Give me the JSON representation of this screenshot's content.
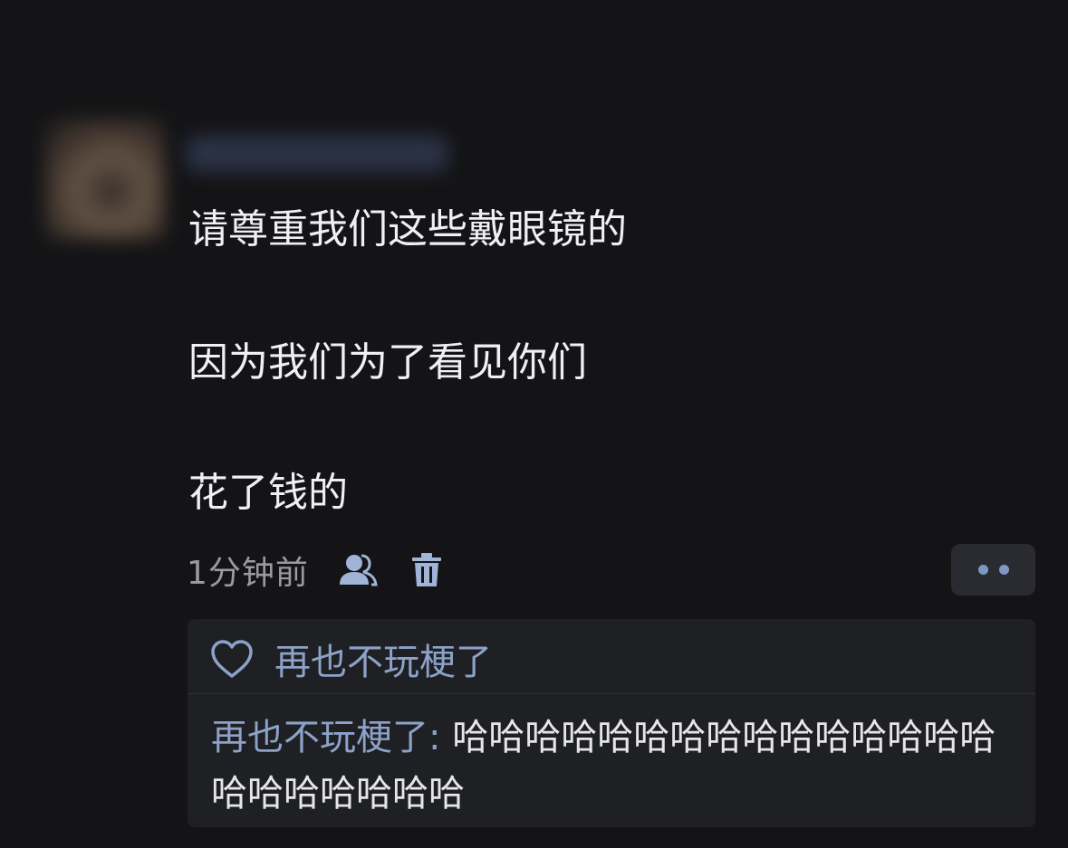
{
  "post": {
    "lines": [
      "请尊重我们这些戴眼镜的",
      "因为我们为了看见你们",
      "花了钱的"
    ],
    "timestamp": "1分钟前",
    "icons": {
      "visibility": "people-icon",
      "delete": "trash-icon",
      "more": "more-dots-icon"
    }
  },
  "likes": {
    "icon": "heart-icon",
    "names": "再也不玩梗了"
  },
  "reply": {
    "author": "再也不玩梗了",
    "separator": ": ",
    "text": "哈哈哈哈哈哈哈哈哈哈哈哈哈哈哈哈哈哈哈哈哈哈"
  },
  "colors": {
    "background": "#141416",
    "link": "#8da2c9",
    "reply_box": "#1f2024"
  }
}
